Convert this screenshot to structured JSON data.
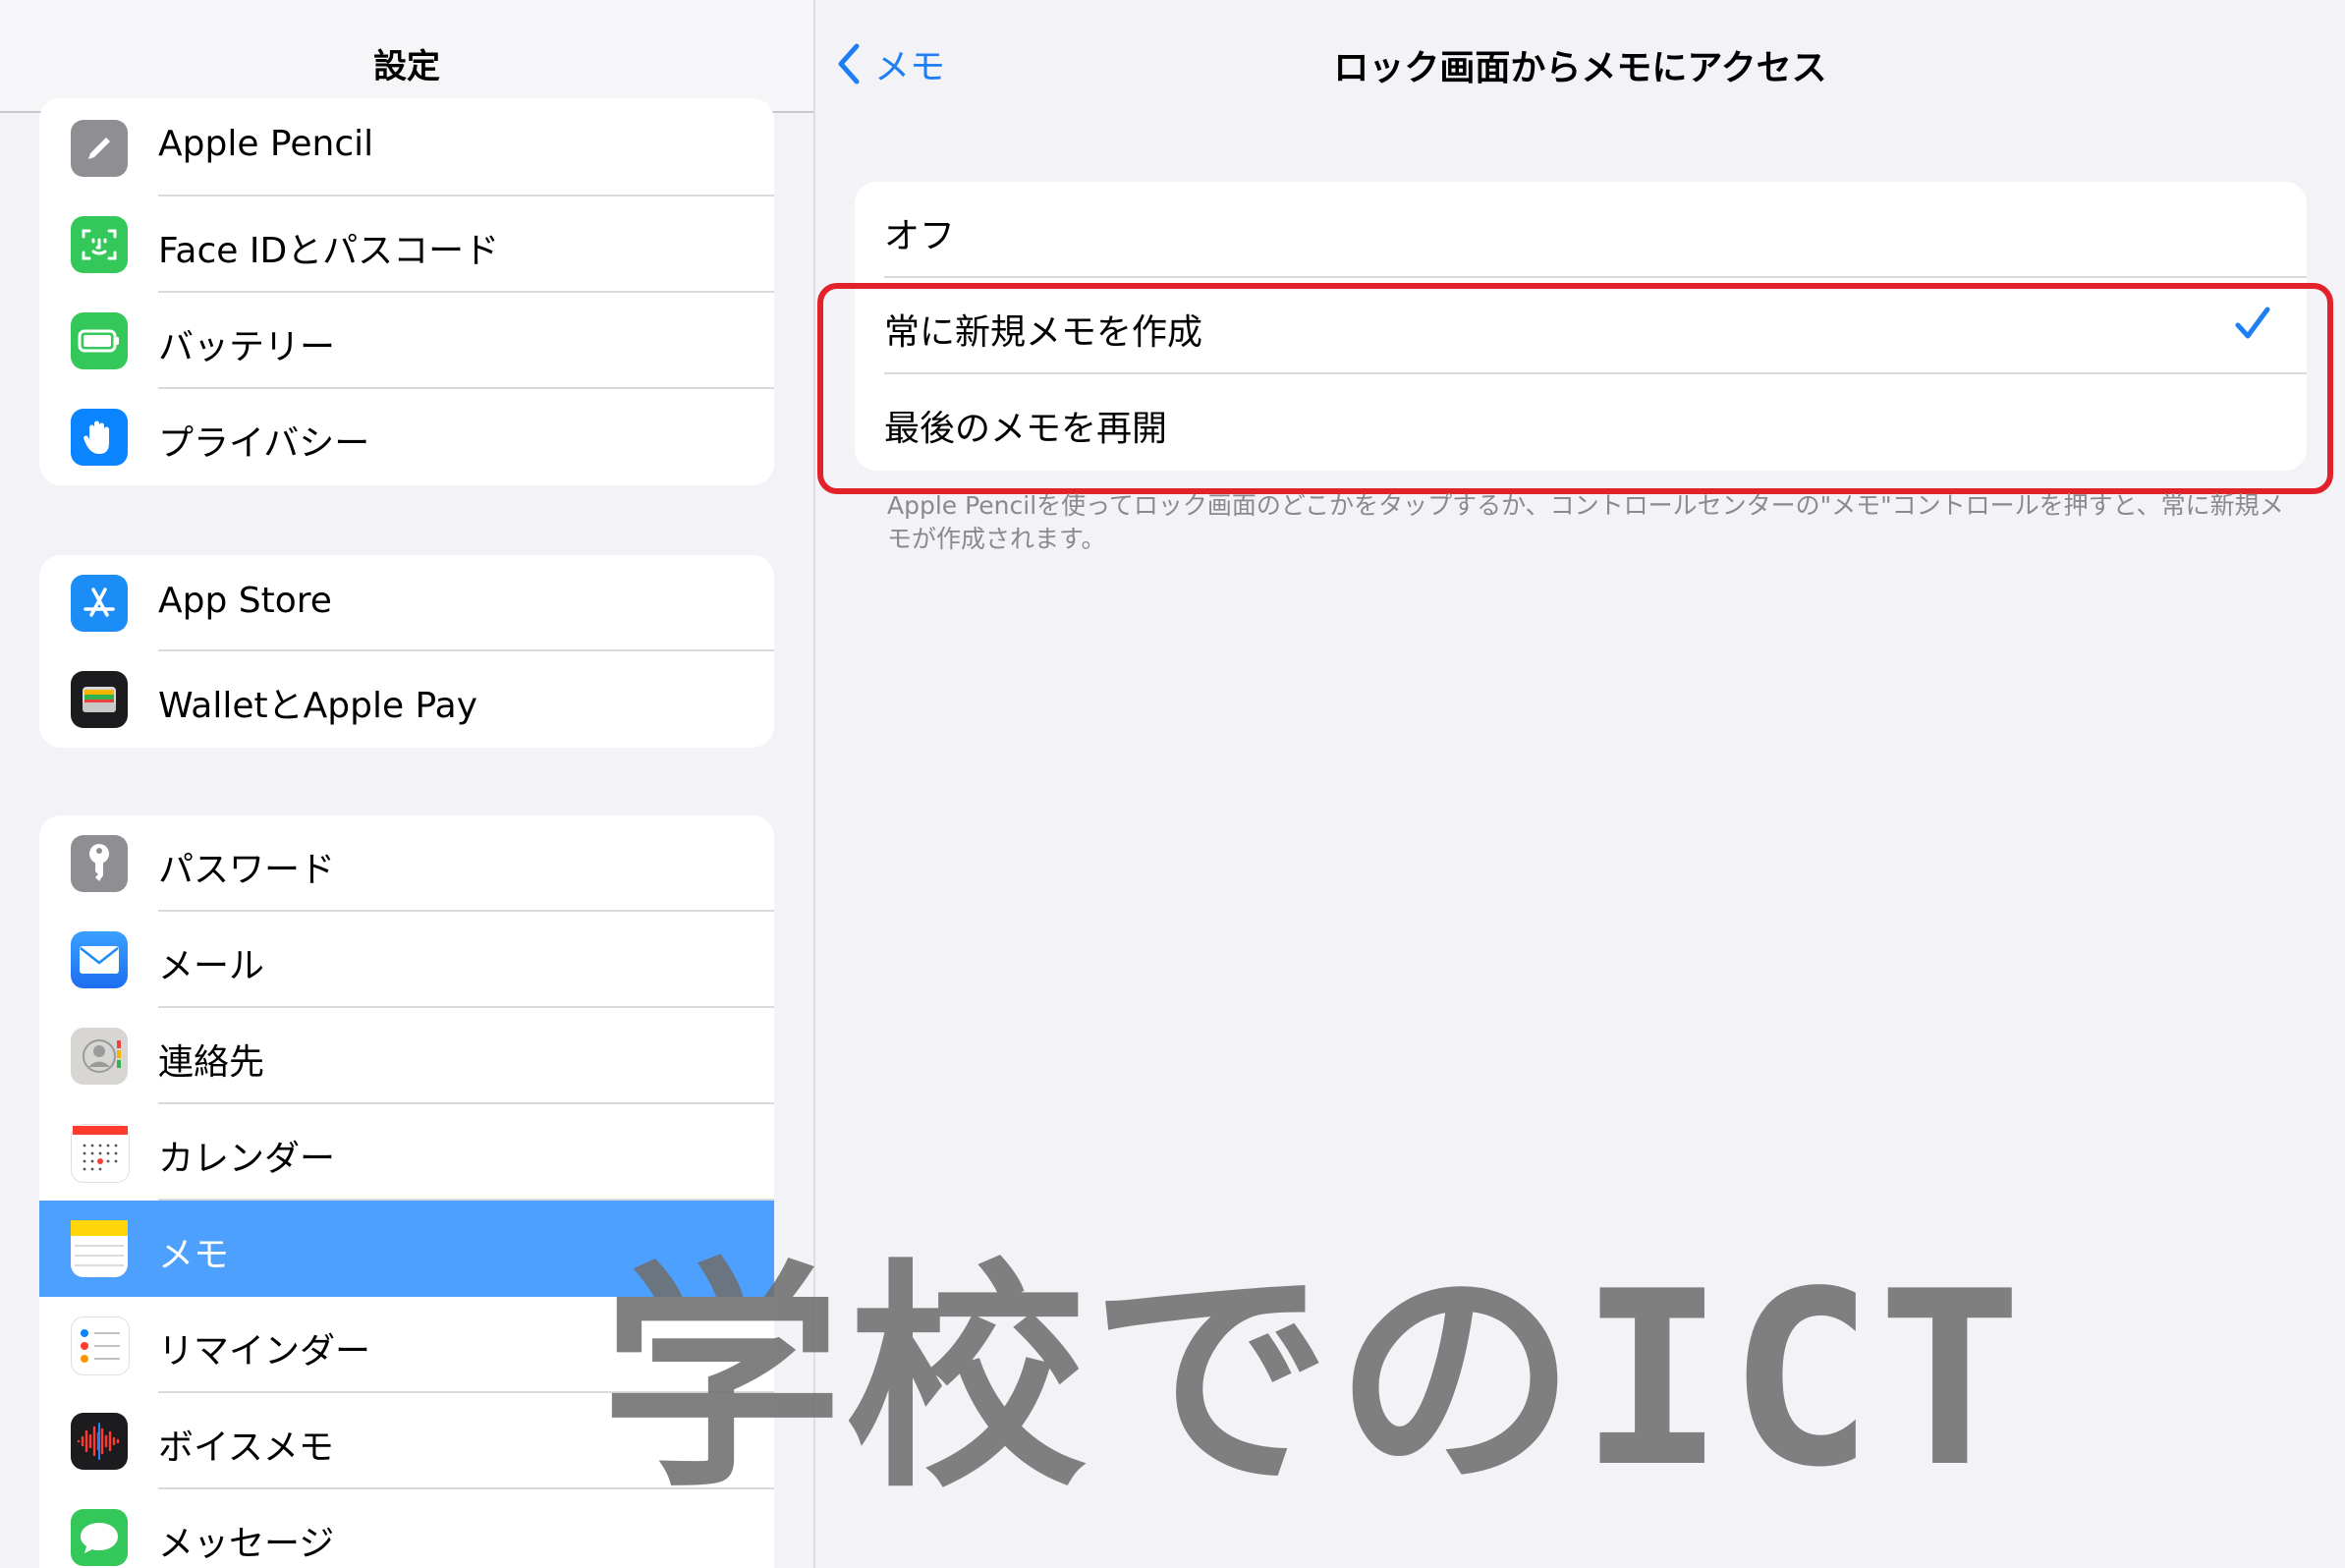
{
  "sidebar": {
    "title": "設定",
    "groups": [
      {
        "items": [
          {
            "label": "Apple Pencil",
            "icon": "pencil-icon",
            "color": "#8e8e93"
          },
          {
            "label": "Face IDとパスコード",
            "icon": "face-id-icon",
            "color": "#34c759"
          },
          {
            "label": "バッテリー",
            "icon": "battery-icon",
            "color": "#34c759"
          },
          {
            "label": "プライバシー",
            "icon": "hand-icon",
            "color": "#0a84ff"
          }
        ]
      },
      {
        "items": [
          {
            "label": "App Store",
            "icon": "app-store-icon",
            "color": "#1c8cf6"
          },
          {
            "label": "WalletとApple Pay",
            "icon": "wallet-icon",
            "color": "#1c1c1e"
          }
        ]
      },
      {
        "items": [
          {
            "label": "パスワード",
            "icon": "key-icon",
            "color": "#8e8e93"
          },
          {
            "label": "メール",
            "icon": "mail-icon",
            "color": "#1c8cf6"
          },
          {
            "label": "連絡先",
            "icon": "contacts-icon",
            "color": "#c9c9cc"
          },
          {
            "label": "カレンダー",
            "icon": "calendar-icon",
            "color": "#ffffff"
          },
          {
            "label": "メモ",
            "icon": "notes-icon",
            "color": "#ffd60a",
            "selected": true
          },
          {
            "label": "リマインダー",
            "icon": "reminders-icon",
            "color": "#ffffff"
          },
          {
            "label": "ボイスメモ",
            "icon": "voice-memo-icon",
            "color": "#1c1c1e"
          },
          {
            "label": "メッセージ",
            "icon": "messages-icon",
            "color": "#34c759"
          }
        ]
      }
    ]
  },
  "detail": {
    "back_label": "メモ",
    "title": "ロック画面からメモにアクセス",
    "options": [
      {
        "label": "オフ",
        "checked": false
      },
      {
        "label": "常に新規メモを作成",
        "checked": true
      },
      {
        "label": "最後のメモを再開",
        "checked": false
      }
    ],
    "footer_note": "Apple Pencilを使ってロック画面のどこかをタップするか、コントロールセンターの\"メモ\"コントロールを押すと、常に新規メモが作成されます。"
  },
  "watermark": "学校でのICT",
  "colors": {
    "accent": "#1e7ef4",
    "selected_row": "#4ea0ff",
    "highlight_border": "#e3212b"
  }
}
